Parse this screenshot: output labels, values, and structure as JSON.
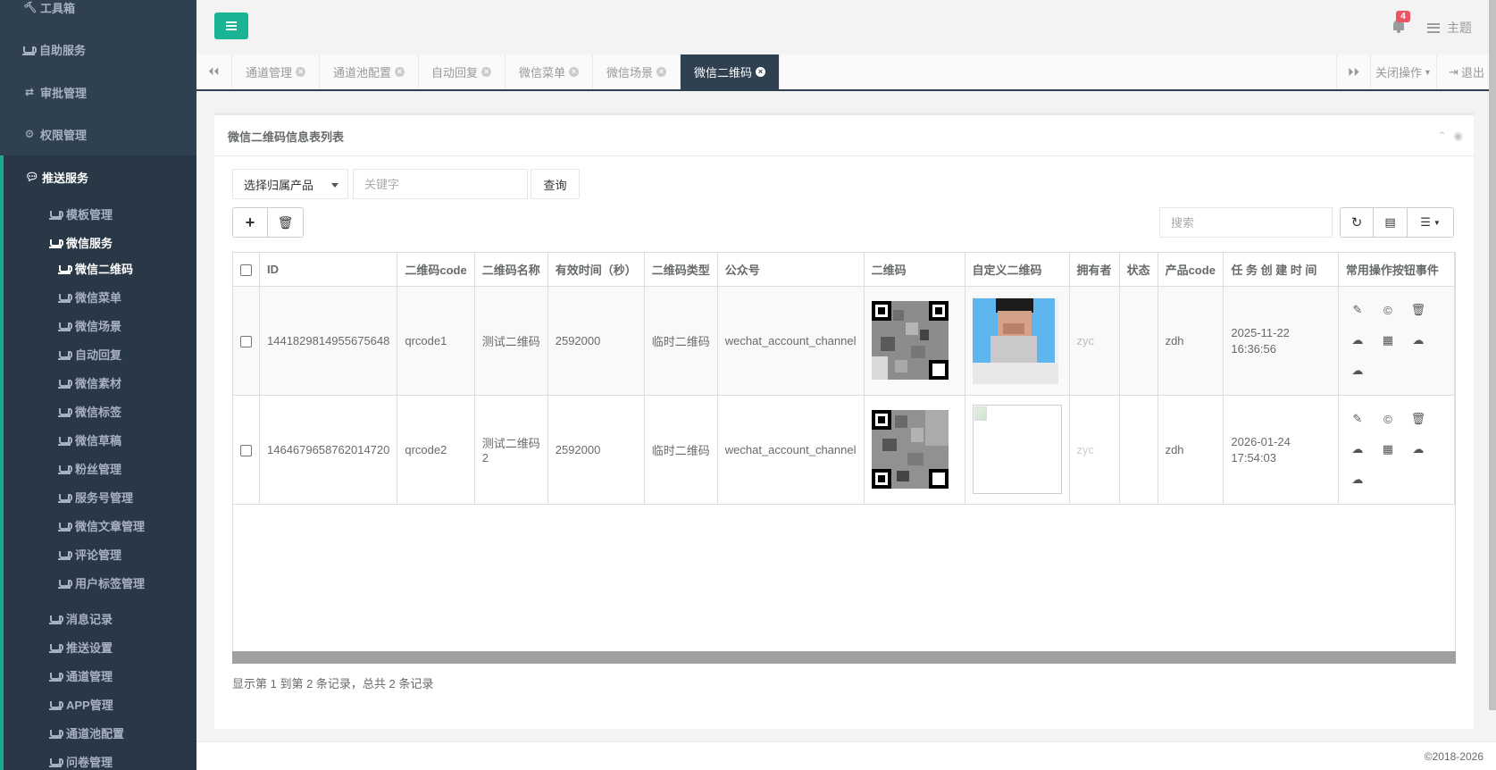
{
  "sidebar": {
    "top_items": [
      {
        "label": "工具箱",
        "icon": "hammer-icon"
      },
      {
        "label": "自助服务",
        "icon": "cup-icon"
      },
      {
        "label": "审批管理",
        "icon": "exchange-icon"
      },
      {
        "label": "权限管理",
        "icon": "gear-icon"
      }
    ],
    "open_section": {
      "label": "推送服务",
      "icon": "comment-icon"
    },
    "groups": [
      {
        "label": "模板管理"
      },
      {
        "label": "微信服务"
      }
    ],
    "wechat_items": [
      {
        "label": "微信二维码",
        "active": true
      },
      {
        "label": "微信菜单"
      },
      {
        "label": "微信场景"
      },
      {
        "label": "自动回复"
      },
      {
        "label": "微信素材"
      },
      {
        "label": "微信标签"
      },
      {
        "label": "微信草稿"
      },
      {
        "label": "粉丝管理"
      },
      {
        "label": "服务号管理"
      },
      {
        "label": "微信文章管理"
      },
      {
        "label": "评论管理"
      },
      {
        "label": "用户标签管理"
      }
    ],
    "bottom_items": [
      {
        "label": "消息记录"
      },
      {
        "label": "推送设置"
      },
      {
        "label": "通道管理"
      },
      {
        "label": "APP管理"
      },
      {
        "label": "通道池配置"
      },
      {
        "label": "问卷管理"
      }
    ]
  },
  "topbar": {
    "notification_count": "4",
    "theme_label": "主题"
  },
  "tabs": {
    "items": [
      {
        "label": "通道管理"
      },
      {
        "label": "通道池配置"
      },
      {
        "label": "自动回复"
      },
      {
        "label": "微信菜单"
      },
      {
        "label": "微信场景"
      },
      {
        "label": "微信二维码",
        "active": true
      }
    ],
    "close_ops_label": "关闭操作",
    "logout_label": "退出"
  },
  "panel": {
    "title": "微信二维码信息表列表",
    "product_select": "选择归属产品",
    "keyword_placeholder": "关键字",
    "query_label": "查询",
    "search_placeholder": "搜索"
  },
  "table": {
    "columns": [
      "ID",
      "二维码code",
      "二维码名称",
      "有效时间（秒）",
      "二维码类型",
      "公众号",
      "二维码",
      "自定义二维码",
      "拥有者",
      "状态",
      "产品code",
      "任 务 创 建 时 间",
      "常用操作按钮事件"
    ],
    "rows": [
      {
        "id": "1441829814955675648",
        "code": "qrcode1",
        "name": "测试二维码",
        "expire": "2592000",
        "type": "临时二维码",
        "account": "wechat_account_channel",
        "owner": "zyc",
        "status": "",
        "product": "zdh",
        "created_date": "2025-11-22",
        "created_time": "16:36:56"
      },
      {
        "id": "1464679658762014720",
        "code": "qrcode2",
        "name": "测试二维码2",
        "expire": "2592000",
        "type": "临时二维码",
        "account": "wechat_account_channel",
        "owner": "zyc",
        "status": "",
        "product": "zdh",
        "created_date": "2026-01-24",
        "created_time": "17:54:03"
      }
    ]
  },
  "pager_text": "显示第 1 到第 2 条记录，总共 2 条记录",
  "footer_text": "©2018-2026",
  "colors": {
    "sidebar_bg": "#2f4050",
    "accent": "#1ab394",
    "badge": "#ed5565"
  }
}
